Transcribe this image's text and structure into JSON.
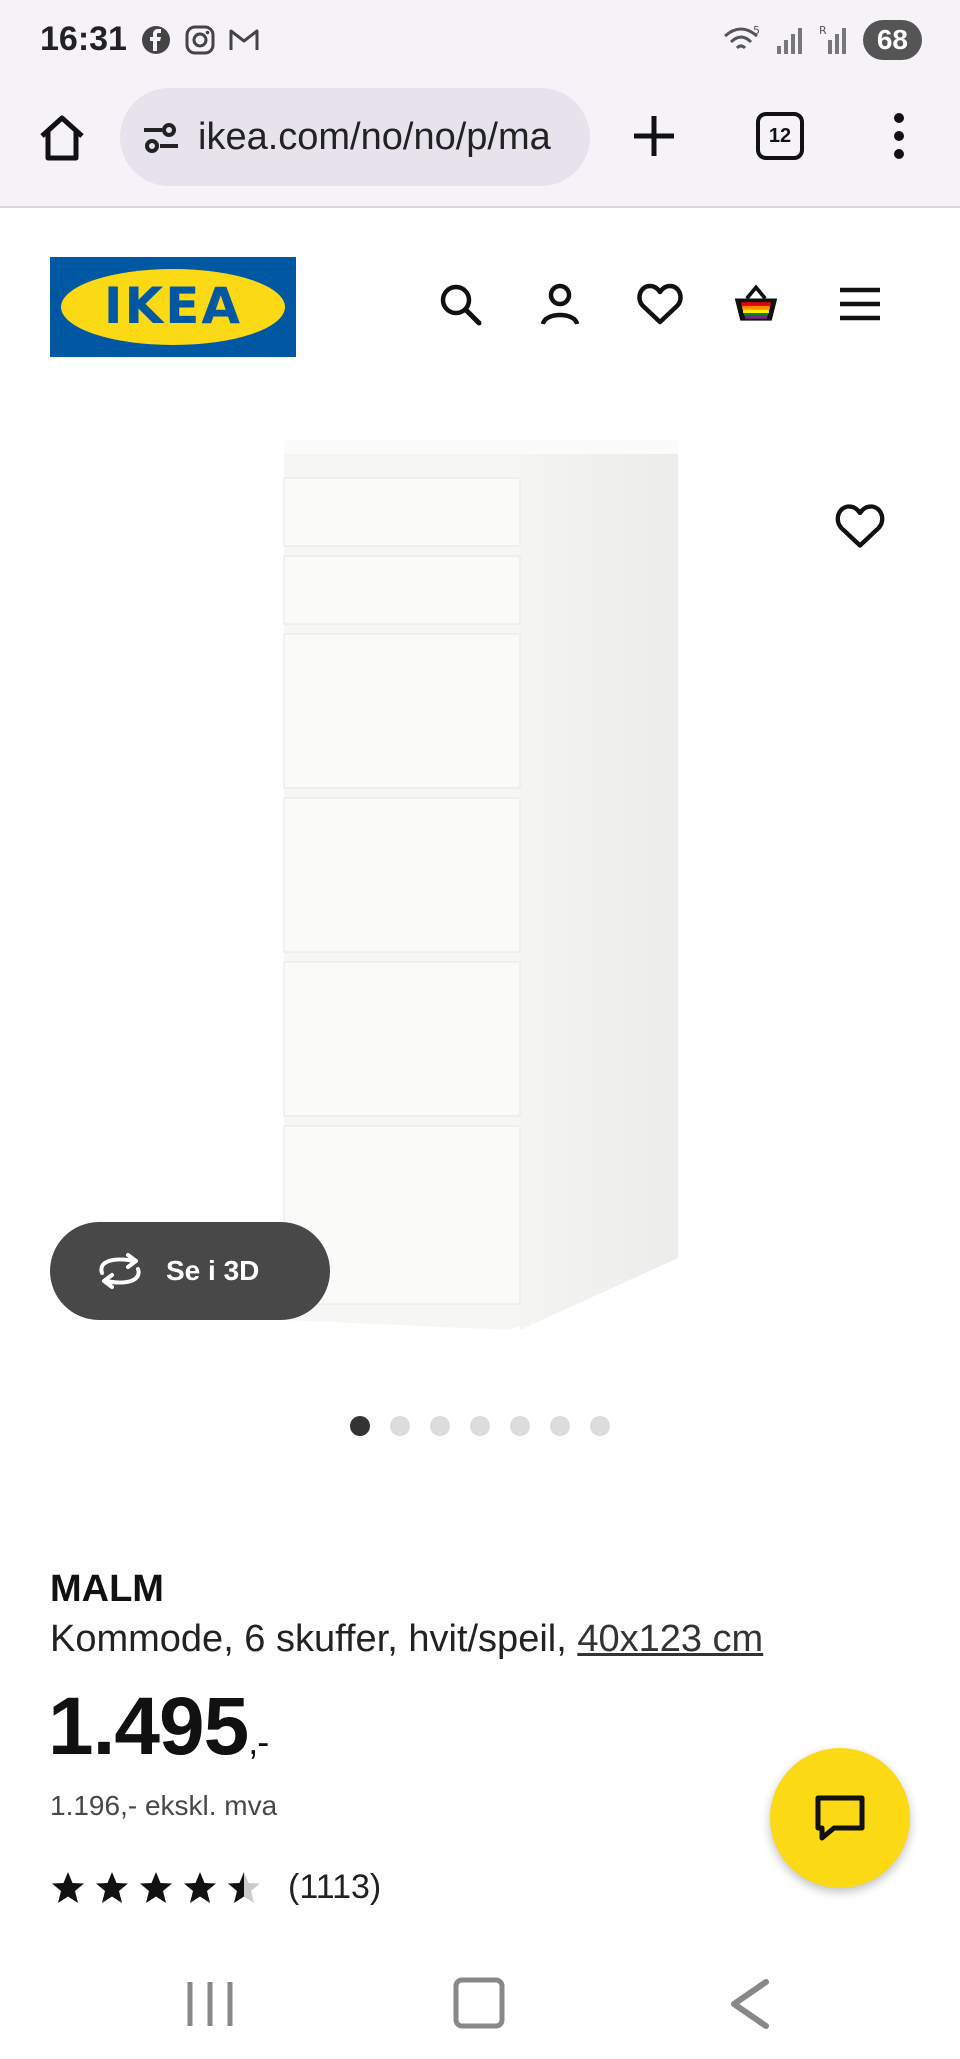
{
  "status_bar": {
    "time": "16:31",
    "battery": "68",
    "left_icons": [
      "facebook-icon",
      "instagram-icon",
      "gmail-icon"
    ],
    "right_icons": [
      "wifi-icon",
      "signal-icon",
      "signal-roaming-icon"
    ]
  },
  "browser": {
    "url": "ikea.com/no/no/p/ma",
    "tab_count": "12"
  },
  "header": {
    "logo_text": "IKEA",
    "icons": [
      "search-icon",
      "account-icon",
      "wishlist-icon",
      "basket-icon",
      "menu-icon"
    ]
  },
  "gallery": {
    "see_3d_label": "Se i 3D",
    "dot_count": 7,
    "active_dot": 0
  },
  "product": {
    "name": "MALM",
    "description": "Kommode, 6 skuffer, hvit/speil, ",
    "dimensions": "40x123 cm",
    "price": "1.495",
    "price_suffix": ",-",
    "price_ex_vat": "1.196,- ekskl. mva",
    "rating": 4.5,
    "rating_max": 5,
    "review_count": "(1113)"
  },
  "colors": {
    "ikea_blue": "#0058a3",
    "ikea_yellow": "#fbd914",
    "see3d_bg": "#484848"
  }
}
